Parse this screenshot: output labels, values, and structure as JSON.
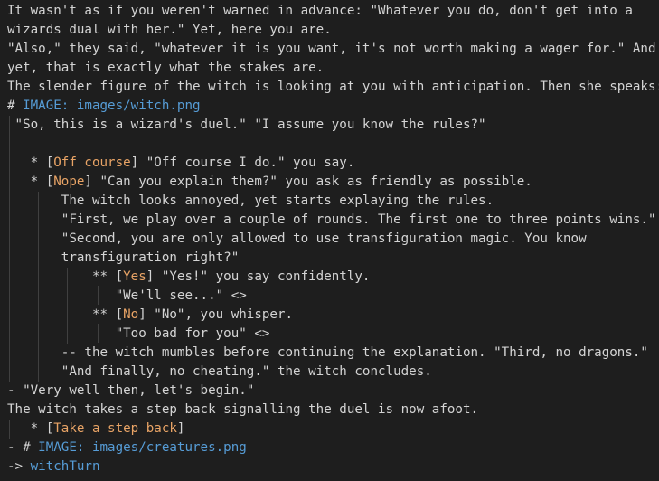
{
  "colors": {
    "background": "#1e1e1e",
    "text": "#d4d4d4",
    "choice_label": "#e9a466",
    "link": "#569cd6",
    "indent_guide": "#404040"
  },
  "lines": [
    {
      "text": "It wasn't as if you weren't warned in advance: \"Whatever you do, don't get into a"
    },
    {
      "text": "wizards dual with her.\" Yet, here you are."
    },
    {
      "text": "\"Also,\" they said, \"whatever it is you want, it's not worth making a wager for.\" And"
    },
    {
      "text": "yet, that is exactly what the stakes are."
    },
    {
      "text": "The slender figure of the witch is looking at you with anticipation. Then she speaks:"
    },
    {
      "pre": "# ",
      "link": "IMAGE: images/witch.png"
    },
    {
      "text": " \"So, this is a wizard's duel.\" \"I assume you know the rules?\""
    },
    {
      "text": ""
    },
    {
      "pre": "   * [",
      "label": "Off course",
      "post": "] \"Off course I do.\" you say."
    },
    {
      "pre": "   * [",
      "label": "Nope",
      "post": "] \"Can you explain them?\" you ask as friendly as possible."
    },
    {
      "text": "       The witch looks annoyed, yet starts explaying the rules."
    },
    {
      "text": "       \"First, we play over a couple of rounds. The first one to three points wins.\""
    },
    {
      "text": "       \"Second, you are only allowed to use transfiguration magic. You know"
    },
    {
      "text": "       transfiguration right?\""
    },
    {
      "pre": "           ** [",
      "label": "Yes",
      "post": "] \"Yes!\" you say confidently."
    },
    {
      "text": "              \"We'll see...\" <>"
    },
    {
      "pre": "           ** [",
      "label": "No",
      "post": "] \"No\", you whisper."
    },
    {
      "text": "              \"Too bad for you\" <>"
    },
    {
      "text": "       -- the witch mumbles before continuing the explanation. \"Third, no dragons.\""
    },
    {
      "text": "       \"And finally, no cheating.\" the witch concludes."
    },
    {
      "text": "- \"Very well then, let's begin.\""
    },
    {
      "text": "The witch takes a step back signalling the duel is now afoot."
    },
    {
      "pre": "   * [",
      "label": "Take a step back",
      "post": "]"
    },
    {
      "pre": "- # ",
      "link": "IMAGE: images/creatures.png"
    },
    {
      "pre": "-> ",
      "link": "witchTurn"
    }
  ]
}
